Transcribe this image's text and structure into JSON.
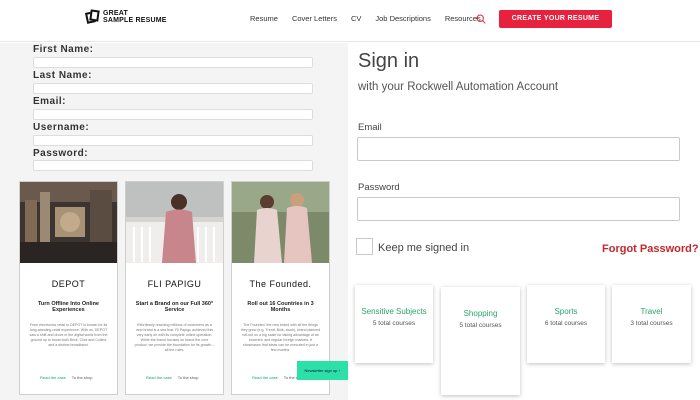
{
  "header": {
    "logo_line1": "GREAT",
    "logo_line2": "SAMPLE RESUME",
    "nav": [
      "Resume",
      "Cover Letters",
      "CV",
      "Job Descriptions",
      "Resources"
    ],
    "cta": "CREATE YOUR RESUME"
  },
  "form": {
    "labels": [
      "First Name:",
      "Last Name:",
      "Email:",
      "Username:",
      "Password:"
    ]
  },
  "cards": [
    {
      "title": "DEPOT",
      "subtitle": "Turn Offline Into Online Experiences",
      "body": "From electronics retail to DEPOT is known for its long-standing retail experience. With us, DEPOT saw a shift and drove in the digital world from the ground up to boost both Brick, Click and Collect and a distinct broadband.",
      "link1": "Read the case",
      "link2": "To the shop"
    },
    {
      "title": "FLI PAPIGU",
      "subtitle": "Start a Brand on our Full 360° Service",
      "body": "Effortlessly reaching millions of customers as a new brand is a sea feat. Fli Papigu achieved this very early on with its complete online operation. While the brand focuses on brand the core product, we provide the foundation for its growth – all the rules.",
      "link1": "Read the case",
      "link2": "To the shop"
    },
    {
      "title": "The Founded.",
      "subtitle": "Roll out 16 Countries in 3 Months",
      "body": "The Founded, the new brand with all the things they grew (e.g. Trend, Bulk, stock), brand planned roll-out on a big scale for taking advantage of an eccentric and regular foreign markets. It showcases that ideas can be executed in just a few months.",
      "link1": "Read the case",
      "link2": "To the shop"
    }
  ],
  "newsletter": "Newsletter sign up ↑",
  "signin": {
    "title": "Sign in",
    "subtitle": "with your Rockwell Automation Account",
    "email_label": "Email",
    "password_label": "Password",
    "keep_label": "Keep me signed in",
    "forgot": "Forgot Password?"
  },
  "courses": [
    {
      "name": "Sensitive Subjects",
      "count": "5 total courses"
    },
    {
      "name": "Shopping",
      "count": "5 total courses"
    },
    {
      "name": "Sports",
      "count": "6 total courses"
    },
    {
      "name": "Travel",
      "count": "3 total courses"
    }
  ],
  "colors": {
    "accent_red": "#e8213f",
    "forgot_red": "#c4262e",
    "course_green": "#2aa46d",
    "newsletter_teal": "#2de0a8"
  }
}
